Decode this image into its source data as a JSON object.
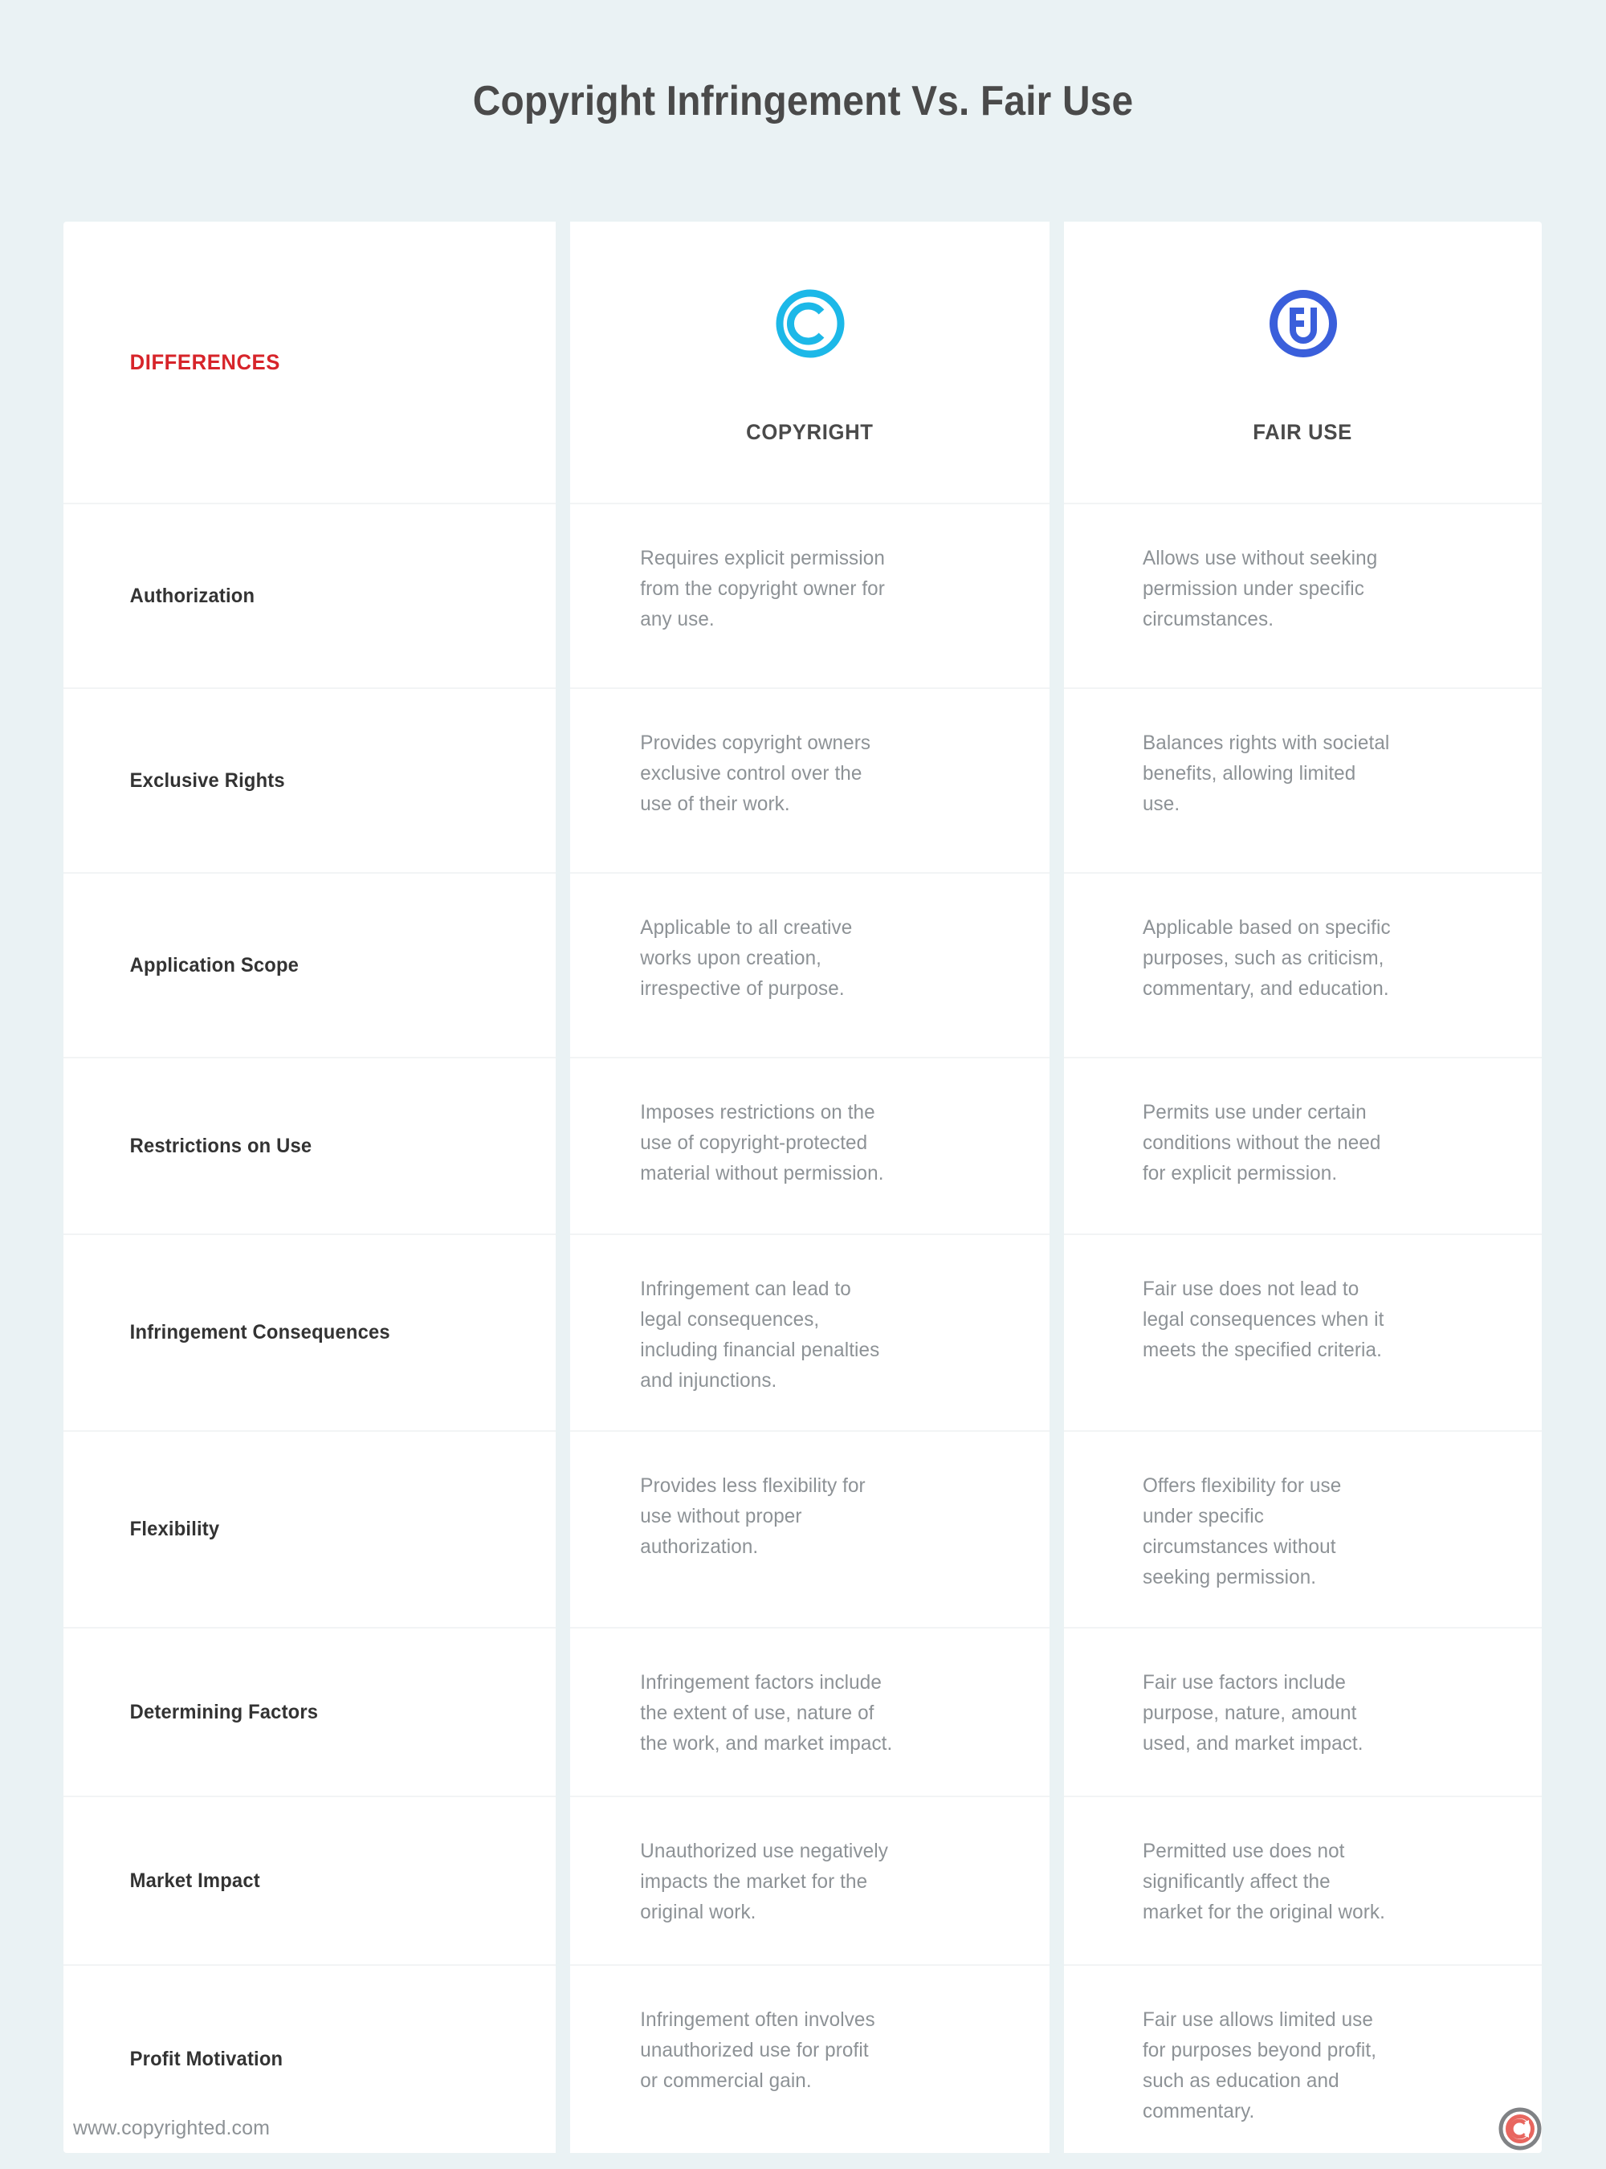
{
  "page": {
    "title": "Copyright Infringement Vs. Fair Use",
    "background_color": "#eaf2f4",
    "title_color": "#4a4a4a"
  },
  "table": {
    "header": {
      "differences_label": "DIFFERENCES",
      "differences_color": "#d7242a",
      "columns": [
        {
          "label": "COPYRIGHT",
          "icon": "copyright-circle-c-icon",
          "icon_color": "#1cb8e8"
        },
        {
          "label": "FAIR USE",
          "icon": "fair-use-circle-fu-icon",
          "icon_color": "#3a5fdb"
        }
      ]
    },
    "rows": [
      {
        "label": "Authorization",
        "copyright": "Requires explicit permission\nfrom the copyright owner for\nany use.",
        "fair_use": "Allows use without seeking\npermission under specific\ncircumstances."
      },
      {
        "label": "Exclusive Rights",
        "copyright": "Provides copyright owners\nexclusive control over the\nuse of their work.",
        "fair_use": "Balances rights with societal\nbenefits, allowing limited\nuse."
      },
      {
        "label": "Application Scope",
        "copyright": "Applicable to all creative\nworks upon creation,\nirrespective of purpose.",
        "fair_use": "Applicable based on specific\npurposes, such as criticism,\ncommentary, and education."
      },
      {
        "label": "Restrictions on Use",
        "copyright": "Imposes restrictions on the\nuse of copyright-protected\nmaterial without permission.",
        "fair_use": "Permits use under certain\nconditions without the need\nfor explicit permission."
      },
      {
        "label": "Infringement Consequences",
        "copyright": "Infringement can lead to\nlegal consequences,\nincluding financial penalties\nand injunctions.",
        "fair_use": "Fair use does not lead to\nlegal consequences when it\nmeets the specified criteria."
      },
      {
        "label": "Flexibility",
        "copyright": "Provides less flexibility for\nuse without proper\nauthorization.",
        "fair_use": "Offers flexibility for use\nunder specific\ncircumstances without\nseeking permission."
      },
      {
        "label": "Determining Factors",
        "copyright": "Infringement factors include\nthe extent of use, nature of\nthe work, and market impact.",
        "fair_use": "Fair use factors include\npurpose, nature, amount\nused, and market impact."
      },
      {
        "label": "Market Impact",
        "copyright": "Unauthorized use negatively\nimpacts the market for the\noriginal work.",
        "fair_use": "Permitted use does not\nsignificantly affect the\nmarket for the original work."
      },
      {
        "label": "Profit Motivation",
        "copyright": "Infringement often involves\nunauthorized use for profit\nor commercial gain.",
        "fair_use": "Fair use allows limited use\nfor purposes beyond profit,\nsuch as education and\ncommentary."
      }
    ]
  },
  "footer": {
    "url": "www.copyrighted.com",
    "logo_icon": "copyrighted-c-logo-icon",
    "logo_ring_color": "#808285",
    "logo_c_color": "#e8665f"
  }
}
